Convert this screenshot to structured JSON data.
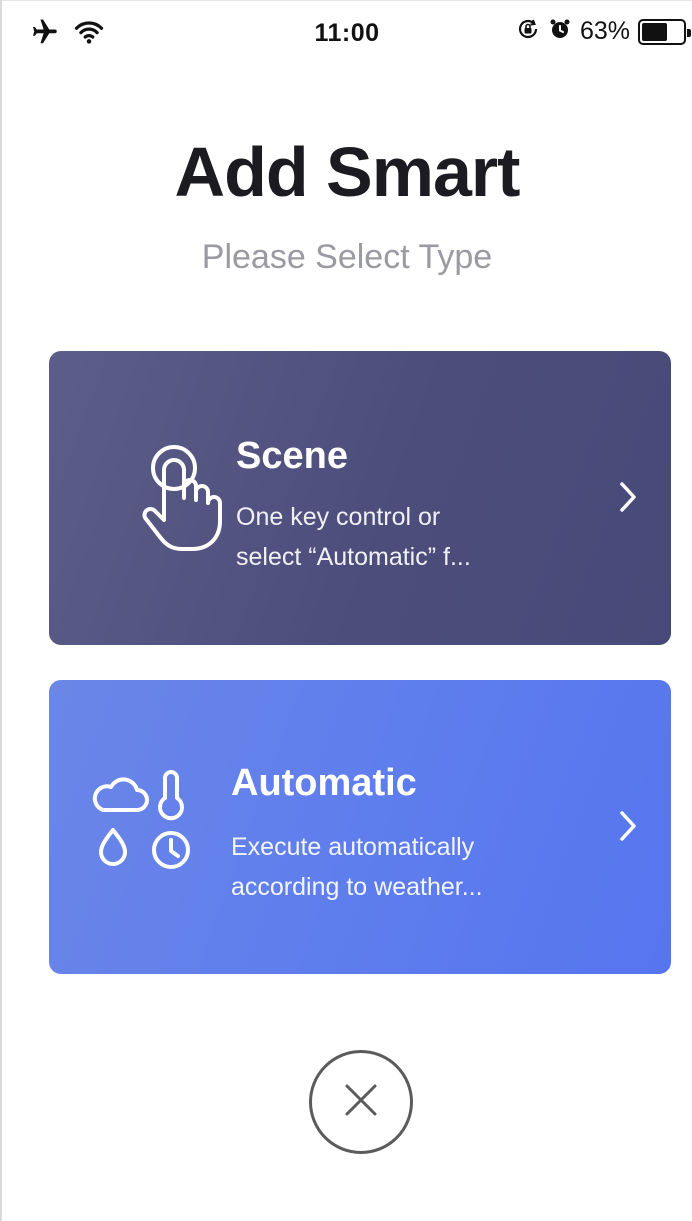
{
  "status_bar": {
    "time": "11:00",
    "battery_percent_label": "63%",
    "battery_level": 0.63,
    "icons": [
      "airplane-icon",
      "wifi-icon",
      "rotation-lock-icon",
      "alarm-icon",
      "battery-icon"
    ]
  },
  "header": {
    "title": "Add Smart",
    "subtitle": "Please Select Type"
  },
  "cards": [
    {
      "title": "Scene",
      "desc_line1": "One key control or",
      "desc_line2": "select “Automatic” f...",
      "icon": "hand-tap-icon"
    },
    {
      "title": "Automatic",
      "desc_line1": "Execute automatically",
      "desc_line2": "according to weather...",
      "icon": "weather-conditions-icon"
    }
  ],
  "close": {
    "icon": "close-icon"
  },
  "colors": {
    "scene_card": "#4f507e",
    "automatic_card": "#5f7eed",
    "title_text": "#1b1b21",
    "subtitle_text": "#9a9aa2"
  }
}
